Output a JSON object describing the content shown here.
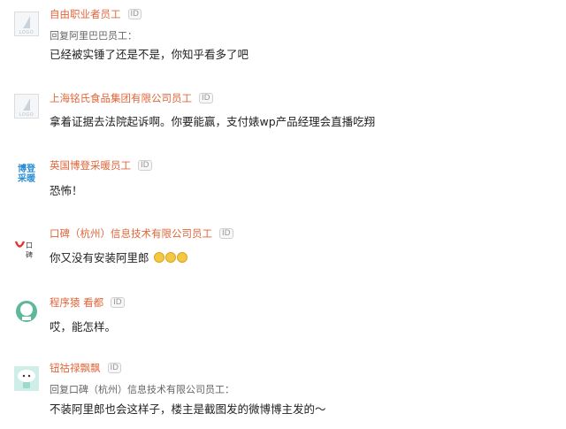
{
  "comments": [
    {
      "username": "自由职业者员工",
      "id_badge": "ID",
      "avatar": "default-logo-avatar",
      "reply_to": "回复阿里巴巴员工：",
      "text": "已经被实锤了还是不是，你知乎看多了吧"
    },
    {
      "username": "上海铭氏食品集团有限公司员工",
      "id_badge": "ID",
      "avatar": "default-logo-avatar",
      "text": "拿着证据去法院起诉啊。你要能赢，支付婊wp产品经理会直播吃翔"
    },
    {
      "username": "英国博登采暖员工",
      "id_badge": "ID",
      "avatar": "company-text-avatar",
      "avatar_text": "博登采暖",
      "text": "恐怖！"
    },
    {
      "username": "口碑（杭州）信息技术有限公司员工",
      "id_badge": "ID",
      "avatar": "koubei-logo-avatar",
      "avatar_text": "口碑",
      "text": "你又没有安装阿里郎",
      "emoji": [
        "grin-emoji",
        "grin-emoji",
        "grin-emoji"
      ]
    },
    {
      "username": "程序猿 看都",
      "id_badge": "ID",
      "avatar": "coder-avatar",
      "text": "哎，能怎样。"
    },
    {
      "username": "钮祜禄飘飘",
      "id_badge": "ID",
      "avatar": "cloud-character-avatar",
      "reply_to": "回复口碑（杭州）信息技术有限公司员工：",
      "text": "不装阿里郎也会这样子，楼主是截图发的微博博主发的～"
    }
  ],
  "default_avatar_label": "LOGO",
  "colors": {
    "username": "#e0663a",
    "text": "#222222",
    "reply": "#666666",
    "accent_blue": "#2e8fd6",
    "koubei_red": "#e8312f"
  }
}
